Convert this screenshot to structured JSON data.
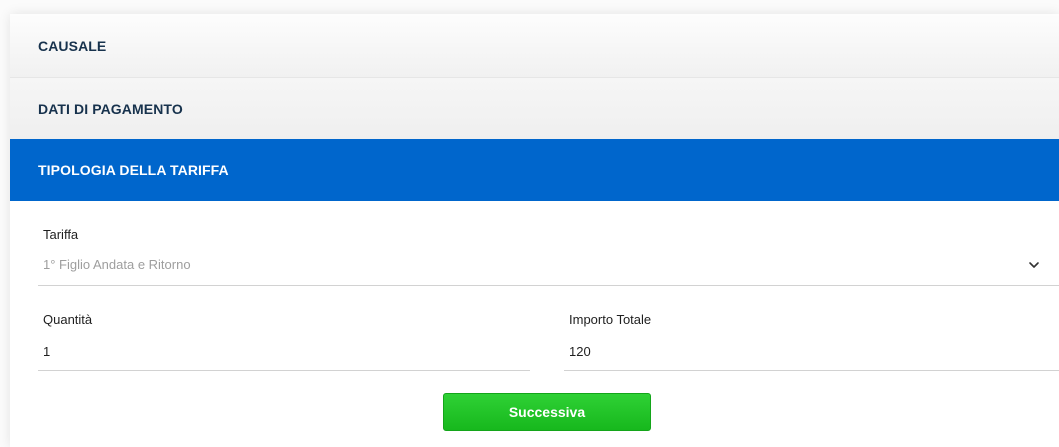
{
  "sections": {
    "causale": "CAUSALE",
    "dati_pagamento": "DATI DI PAGAMENTO",
    "tipologia_tariffa": "TIPOLOGIA DELLA TARIFFA"
  },
  "form": {
    "tariffa": {
      "label": "Tariffa",
      "selected": "1° Figlio Andata e Ritorno"
    },
    "quantita": {
      "label": "Quantità",
      "value": "1"
    },
    "importo_totale": {
      "label": "Importo Totale",
      "value": "120"
    }
  },
  "actions": {
    "next_label": "Successiva"
  },
  "colors": {
    "accent": "#0066cc",
    "success": "#1fc226"
  },
  "icons": {
    "select": "chevron-down-icon"
  }
}
